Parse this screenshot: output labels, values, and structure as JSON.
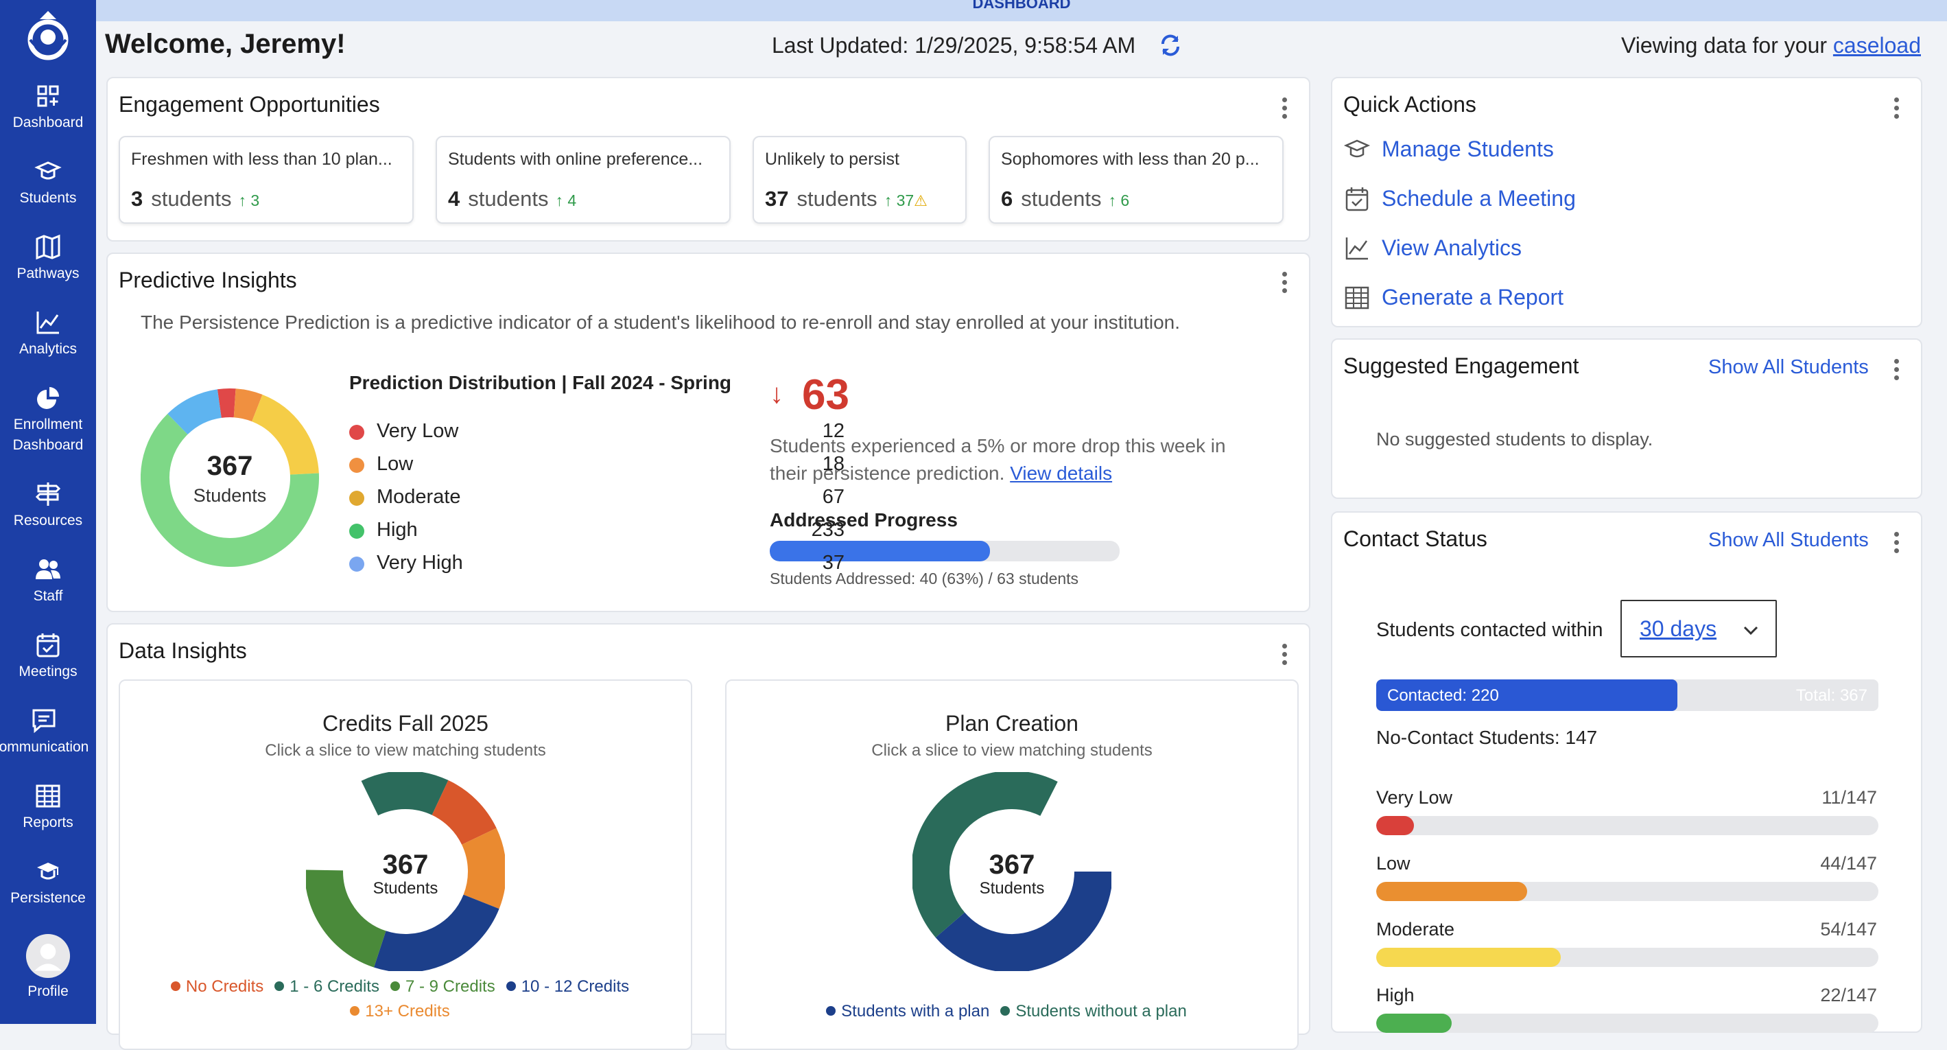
{
  "colors": {
    "sidebar": "#1c3fa6",
    "accent": "#2a5bd7",
    "very_low": "#e04848",
    "low": "#f09040",
    "moderate": "#f5cd47",
    "high": "#7ed887",
    "very_high": "#5eb4f0",
    "progress": "#3a73e8"
  },
  "topbar": {
    "label": "DASHBOARD"
  },
  "sidebar": {
    "items": [
      {
        "label": "Dashboard",
        "icon": "dashboard-icon"
      },
      {
        "label": "Students",
        "icon": "graduation-cap-icon"
      },
      {
        "label": "Pathways",
        "icon": "map-icon"
      },
      {
        "label": "Analytics",
        "icon": "line-chart-icon"
      },
      {
        "label": "Enrollment",
        "label2": "Dashboard",
        "icon": "pie-chart-icon"
      },
      {
        "label": "Resources",
        "icon": "signpost-icon"
      },
      {
        "label": "Staff",
        "icon": "people-icon"
      },
      {
        "label": "Meetings",
        "icon": "calendar-check-icon"
      },
      {
        "label": "ommunication",
        "icon": "chat-icon"
      },
      {
        "label": "Reports",
        "icon": "table-icon"
      },
      {
        "label": "Persistence",
        "icon": "graduation-cap-icon"
      },
      {
        "label": "Profile",
        "icon": "avatar-icon"
      }
    ]
  },
  "header": {
    "welcome": "Welcome, Jeremy!",
    "last_updated": "Last Updated: 1/29/2025, 9:58:54 AM",
    "viewing_prefix": "Viewing data for your ",
    "viewing_link": "caseload"
  },
  "engagement": {
    "title": "Engagement Opportunities",
    "boxes": [
      {
        "title": "Freshmen with less than 10 plan...",
        "count": "3",
        "unit": "students",
        "delta": "↑ 3",
        "warn": ""
      },
      {
        "title": "Students with online preference...",
        "count": "4",
        "unit": "students",
        "delta": "↑ 4",
        "warn": ""
      },
      {
        "title": "Unlikely to persist",
        "count": "37",
        "unit": "students",
        "delta": "↑ 37",
        "warn": "⚠"
      },
      {
        "title": "Sophomores with less than 20 p...",
        "count": "6",
        "unit": "students",
        "delta": "↑ 6",
        "warn": ""
      }
    ]
  },
  "predictive": {
    "title": "Predictive Insights",
    "description": "The Persistence Prediction is a predictive indicator of a student's likelihood to re-enroll and stay enrolled at your institution.",
    "donut_total": "367",
    "donut_label": "Students",
    "dist_title": "Prediction Distribution | Fall 2024 - Spring",
    "legend": [
      {
        "label": "Very Low",
        "value": "12",
        "color": "#e04848"
      },
      {
        "label": "Low",
        "value": "18",
        "color": "#f09040"
      },
      {
        "label": "Moderate",
        "value": "67",
        "color": "#e0a830"
      },
      {
        "label": "High",
        "value": "233",
        "color": "#43c26a"
      },
      {
        "label": "Very High",
        "value": "37",
        "color": "#7aa6f0"
      }
    ],
    "drop_arrow": "↓",
    "drop_value": "63",
    "drop_text_1": "Students experienced a 5% or more drop this week in",
    "drop_text_2": "their persistence prediction. ",
    "drop_link": "View details",
    "progress_title": "Addressed Progress",
    "progress_fraction": 0.63,
    "progress_text": "Students Addressed: 40 (63%) / 63 students"
  },
  "data_insights": {
    "title": "Data Insights",
    "credits": {
      "title": "Credits Fall 2025",
      "subtitle": "Click a slice to view matching students",
      "total": "367",
      "label": "Students",
      "legend": [
        {
          "label": "No Credits",
          "color": "#d9572b"
        },
        {
          "label": "1 - 6 Credits",
          "color": "#2a6b5a"
        },
        {
          "label": "7 - 9 Credits",
          "color": "#4a8a3a"
        },
        {
          "label": "10 - 12 Credits",
          "color": "#1c3f8a"
        },
        {
          "label": "13+ Credits",
          "color": "#ea8a30"
        }
      ]
    },
    "plan": {
      "title": "Plan Creation",
      "subtitle": "Click a slice to view matching students",
      "total": "367",
      "label": "Students",
      "legend": [
        {
          "label": "Students with a plan",
          "color": "#1c3f8a"
        },
        {
          "label": "Students without a plan",
          "color": "#2a6b5a"
        }
      ]
    }
  },
  "quick_actions": {
    "title": "Quick Actions",
    "items": [
      {
        "label": "Manage Students",
        "icon": "graduation-cap-icon"
      },
      {
        "label": "Schedule a Meeting",
        "icon": "calendar-check-icon"
      },
      {
        "label": "View Analytics",
        "icon": "line-chart-icon"
      },
      {
        "label": "Generate a Report",
        "icon": "table-icon"
      }
    ]
  },
  "suggested": {
    "title": "Suggested Engagement",
    "show_all": "Show All Students",
    "empty": "No suggested students to display."
  },
  "contact": {
    "title": "Contact Status",
    "show_all": "Show All Students",
    "within_label": "Students contacted within",
    "within_value": "30 days",
    "contacted_label": "Contacted: 220",
    "total_label": "Total: 367",
    "contacted_fraction": 0.6,
    "no_contact": "No-Contact Students: 147",
    "rows": [
      {
        "label": "Very Low",
        "value": "11/147",
        "fraction": 0.075,
        "color": "#d9403a"
      },
      {
        "label": "Low",
        "value": "44/147",
        "fraction": 0.3,
        "color": "#ea8f30"
      },
      {
        "label": "Moderate",
        "value": "54/147",
        "fraction": 0.367,
        "color": "#f6d84f"
      },
      {
        "label": "High",
        "value": "22/147",
        "fraction": 0.15,
        "color": "#4caf50"
      }
    ]
  }
}
